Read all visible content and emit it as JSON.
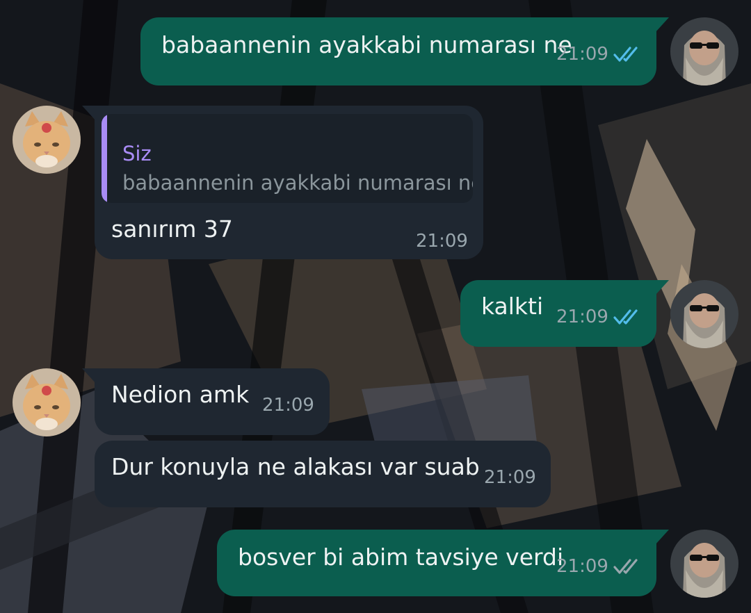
{
  "messages": [
    {
      "direction": "outgoing",
      "text": "babaannenin ayakkabi numarası ne",
      "time": "21:09",
      "status": "read-double-check-icon"
    },
    {
      "direction": "incoming",
      "reply_to": {
        "sender": "Siz",
        "text": "babaannenin ayakkabi numarası ne"
      },
      "text": "sanırım 37",
      "time": "21:09"
    },
    {
      "direction": "outgoing",
      "text": "kalkti",
      "time": "21:09",
      "status": "read-double-check-icon"
    },
    {
      "direction": "incoming",
      "text": "Nedion amk",
      "time": "21:09"
    },
    {
      "direction": "incoming",
      "text": "Dur konuyla ne alakası var suab",
      "time": "21:09"
    },
    {
      "direction": "outgoing",
      "text": "bosver bi abim tavsiye verdi",
      "time": "21:09",
      "status": "delivered-double-check-icon"
    }
  ],
  "colors": {
    "outgoing_bubble": "#0b5e4f",
    "incoming_bubble": "#1f2731",
    "read_ticks": "#53bdeb",
    "delivered_ticks": "#9aa7ae",
    "quote_accent": "#a98cf5"
  },
  "avatars": {
    "outgoing": "bearded-man-sunglasses-avatar",
    "incoming": "orange-cat-avatar"
  }
}
